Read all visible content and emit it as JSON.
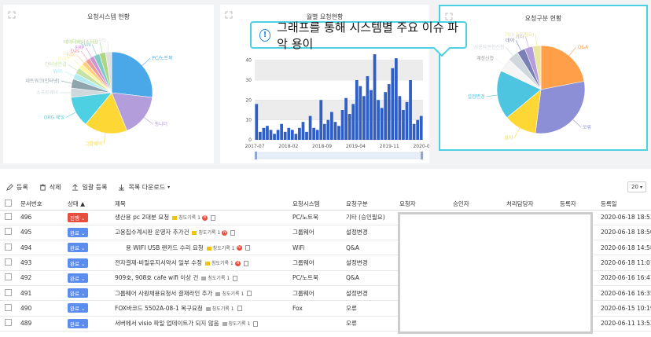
{
  "callout": {
    "text": "그래프를 통해 시스템별 주요 이슈 파악 용이",
    "icon": "!"
  },
  "charts": {
    "system": {
      "title": "요청시스템 현황"
    },
    "monthly": {
      "title": "월별 요청현황"
    },
    "type": {
      "title": "요청구분 현황"
    }
  },
  "chart_data": [
    {
      "type": "pie",
      "title": "요청시스템 현황",
      "labels": [
        "PC/노트북",
        "칭니더",
        "그룹웨어",
        "ERP",
        "메일",
        "ORG 메일",
        "소프트웨어",
        "네트워크(인터넷)",
        "WiFi",
        "인터넷연결",
        "휴대폰",
        "Fox",
        "Das",
        "ERP",
        "SVN",
        "데이터베이스저장",
        "기타"
      ],
      "values": [
        22,
        14,
        14,
        0,
        0,
        10,
        3,
        3,
        2,
        2,
        1.5,
        1.5,
        1.5,
        1.5,
        2,
        2,
        2
      ],
      "colors": [
        "#4aa8e8",
        "#b39ddb",
        "#fdd835",
        "#ffffff",
        "#ffffff",
        "#4dd0e1",
        "#cfd8dc",
        "#90a4ae",
        "#b2ebf2",
        "#c5e1a5",
        "#fff59d",
        "#ffcc80",
        "#ef9a9a",
        "#ce93d8",
        "#80cbc4",
        "#aed581",
        "#e0e0e0"
      ]
    },
    {
      "type": "bar",
      "title": "월별 요청현황",
      "x_ticks": [
        "2017-07",
        "2018-02",
        "2018-09",
        "2019-04",
        "2019-11",
        "2020-06"
      ],
      "ylim": [
        0,
        45
      ],
      "y_ticks": [
        0,
        10,
        20,
        30,
        40
      ],
      "values": [
        18,
        4,
        6,
        7,
        5,
        3,
        5,
        8,
        4,
        6,
        5,
        3,
        6,
        9,
        4,
        12,
        6,
        5,
        20,
        8,
        10,
        14,
        9,
        7,
        15,
        21,
        13,
        18,
        30,
        27,
        22,
        32,
        25,
        43,
        20,
        16,
        24,
        28,
        36,
        41,
        22,
        15,
        19,
        30,
        8,
        10,
        12
      ]
    },
    {
      "type": "pie",
      "title": "요청구분 현황",
      "labels": [
        "Q&A",
        "오류",
        "설치",
        "설정변경",
        "계정신청",
        "사용자권한신청",
        "데이",
        "기타",
        "기타(승인필요)"
      ],
      "values": [
        22,
        30,
        12,
        18,
        5,
        4,
        3,
        3,
        3
      ],
      "colors": [
        "#ff9f4a",
        "#8c8fd6",
        "#fdd835",
        "#4dc4e0",
        "#f5f5f5",
        "#cfd8dc",
        "#7b7fb8",
        "#b39ddb",
        "#e8e6a0"
      ]
    }
  ],
  "toolbar": {
    "register": "등록",
    "delete": "삭제",
    "bulk": "일괄 등록",
    "download": "목록 다운로드",
    "page_size": "20"
  },
  "table": {
    "headers": [
      "문서번호",
      "상태",
      "제목",
      "요청시스템",
      "요청구분",
      "요청자",
      "승인자",
      "처리담당자",
      "등록자",
      "등록일"
    ],
    "rows": [
      {
        "no": "496",
        "status": "진행",
        "status_color": "red",
        "title": "생산용 pc 2대분 요청",
        "tag": "칭도기록",
        "tag_n": "1",
        "new": true,
        "sys": "PC/노트북",
        "kind": "기타 (승인필요)",
        "date": "2020-06-18 18:53"
      },
      {
        "no": "495",
        "status": "완료",
        "status_color": "blue",
        "title": "고용집수계시판 운영자 추가건",
        "tag": "칭도기록",
        "tag_n": "1",
        "new": true,
        "sys": "그룹웨어",
        "kind": "설정변경",
        "date": "2020-06-18 18:50"
      },
      {
        "no": "494",
        "status": "완료",
        "status_color": "blue",
        "title": "용 WIFI USB 랜카드 수리 요청",
        "tag": "칭도기록",
        "tag_n": "1",
        "new": true,
        "sys": "WiFi",
        "kind": "Q&A",
        "date": "2020-06-18 14:58"
      },
      {
        "no": "493",
        "status": "완료",
        "status_color": "blue",
        "title": "전자결재-비밀유지서약서 일부 수정",
        "tag": "칭도기록",
        "tag_n": "1",
        "new": true,
        "sys": "그룹웨어",
        "kind": "설정변경",
        "date": "2020-06-18 11:01"
      },
      {
        "no": "492",
        "status": "완료",
        "status_color": "blue",
        "title": "909호, 908호 cafe wifi 이상 건",
        "tag": "칭도기록",
        "tag_n": "1",
        "new": false,
        "sys": "PC/노트북",
        "kind": "Q&A",
        "date": "2020-06-16 16:47"
      },
      {
        "no": "491",
        "status": "완료",
        "status_color": "blue",
        "title": "그룹웨어 사원채용요청서 결재라인 추가",
        "tag": "칭도기록",
        "tag_n": "1",
        "new": false,
        "sys": "그룹웨어",
        "kind": "설정변경",
        "date": "2020-06-16 16:35"
      },
      {
        "no": "490",
        "status": "완료",
        "status_color": "blue",
        "title": "FOX바코드 5502A-08-1 복구요청",
        "tag": "칭도기록",
        "tag_n": "1",
        "new": false,
        "sys": "Fox",
        "kind": "오류",
        "date": "2020-06-15 10:19"
      },
      {
        "no": "489",
        "status": "완료",
        "status_color": "blue",
        "title": "서버에서 visio 파일 업데이트가 되지 않음",
        "tag": "칭도기록",
        "tag_n": "1",
        "new": false,
        "sys": "",
        "kind": "오류",
        "date": "2020-06-11 13:52"
      }
    ]
  }
}
